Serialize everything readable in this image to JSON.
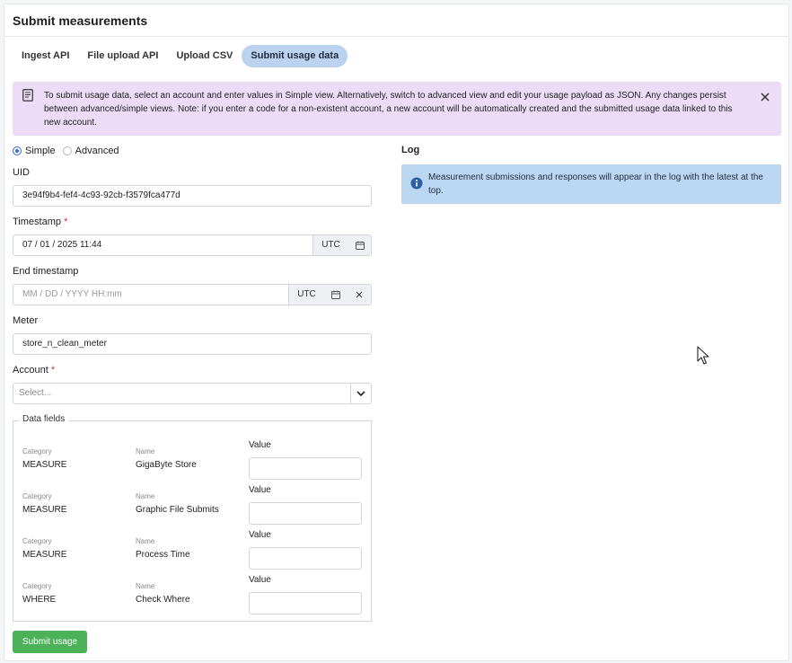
{
  "page": {
    "title": "Submit measurements"
  },
  "tabs": [
    {
      "label": "Ingest API",
      "active": false
    },
    {
      "label": "File upload API",
      "active": false
    },
    {
      "label": "Upload CSV",
      "active": false
    },
    {
      "label": "Submit usage data",
      "active": true
    }
  ],
  "banner": {
    "icon": "document-icon",
    "text": "To submit usage data, select an account and enter values in Simple view. Alternatively, switch to advanced view and edit your usage payload as JSON. Any changes persist between advanced/simple views. Note: if you enter a code for a non-existent account, a new account will be automatically created and the submitted usage data linked to this new account.",
    "background": "#ecdcf8"
  },
  "view_mode": {
    "simple_label": "Simple",
    "advanced_label": "Advanced",
    "selected": "Simple"
  },
  "form": {
    "uid": {
      "label": "UID",
      "value": "3e94f9b4-fef4-4c93-92cb-f3579fca477d"
    },
    "timestamp": {
      "label": "Timestamp",
      "required": "*",
      "value": "07 / 01 / 2025 11:44",
      "tz": "UTC"
    },
    "end_timestamp": {
      "label": "End timestamp",
      "placeholder": "MM / DD / YYYY HH:mm",
      "tz": "UTC"
    },
    "meter": {
      "label": "Meter",
      "value": "store_n_clean_meter"
    },
    "account": {
      "label": "Account",
      "required": "*",
      "placeholder": "Select..."
    },
    "data_fields": {
      "legend": "Data fields",
      "category_label": "Category",
      "name_label": "Name",
      "value_label": "Value",
      "rows": [
        {
          "category": "MEASURE",
          "name": "GigaByte Store",
          "value": ""
        },
        {
          "category": "MEASURE",
          "name": "Graphic File Submits",
          "value": ""
        },
        {
          "category": "MEASURE",
          "name": "Process Time",
          "value": ""
        },
        {
          "category": "WHERE",
          "name": "Check Where",
          "value": ""
        }
      ]
    },
    "submit_label": "Submit usage"
  },
  "log": {
    "title": "Log",
    "info_text": "Measurement submissions and responses will appear in the log with the latest at the top.",
    "background": "#bcd7f2"
  },
  "colors": {
    "accent": "#2f6fd1",
    "submit": "#4bb25a",
    "required": "#d0342c",
    "tab_active": "#bcd3ef"
  }
}
